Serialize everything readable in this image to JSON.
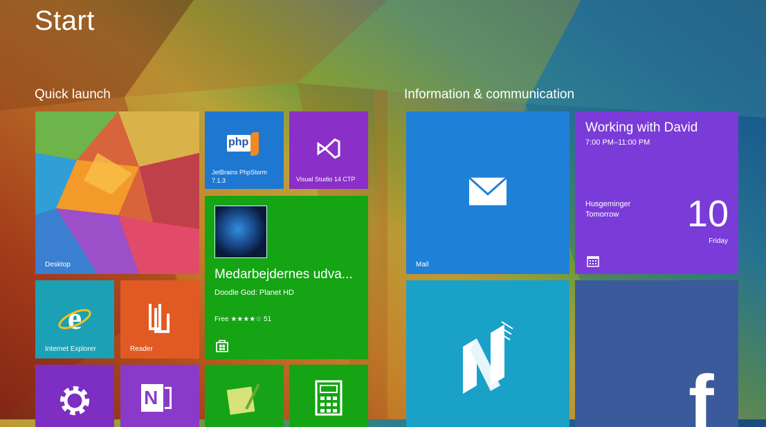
{
  "screen": {
    "title": "Start"
  },
  "groups": {
    "quick_launch": "Quick launch",
    "info_comm": "Information & communication"
  },
  "tiles": {
    "desktop": {
      "label": "Desktop"
    },
    "phpstorm": {
      "label_line1": "JetBrains PhpStorm",
      "label_line2": "7.1.3",
      "logo_text": "php"
    },
    "visual_studio": {
      "label": "Visual Studio 14 CTP"
    },
    "store": {
      "title": "Medarbejdernes udva...",
      "subtitle": "Doodle God: Planet HD",
      "price": "Free ★★★★☆ 51"
    },
    "internet_explorer": {
      "label": "Internet Explorer"
    },
    "reader": {
      "label": "Reader"
    },
    "mail": {
      "label": "Mail"
    },
    "calendar": {
      "event_title": "Working with David",
      "event_time": "7:00 PM–11:00 PM",
      "next_event": "Husgeminger",
      "next_when": "Tomorrow",
      "day_number": "10",
      "day_name": "Friday"
    }
  },
  "colors": {
    "blue_tile": "#1f7fd6",
    "green_tile": "#12a012",
    "purple_tile": "#7b2fc0",
    "calendar_purple": "#7a3bd9",
    "teal_tile": "#1c9fb5",
    "orange_tile": "#e2581f",
    "news_tile": "#1aa0c7",
    "facebook_tile": "#3a5a9b"
  },
  "icons": {
    "mail": "envelope-icon",
    "store": "store-bag-icon",
    "calendar": "calendar-grid-icon",
    "ie": "internet-explorer-icon",
    "reader": "reader-icon",
    "settings": "gear-icon",
    "onenote": "onenote-icon",
    "calculator": "calculator-icon",
    "news": "news-n-icon",
    "facebook": "facebook-f-icon"
  }
}
